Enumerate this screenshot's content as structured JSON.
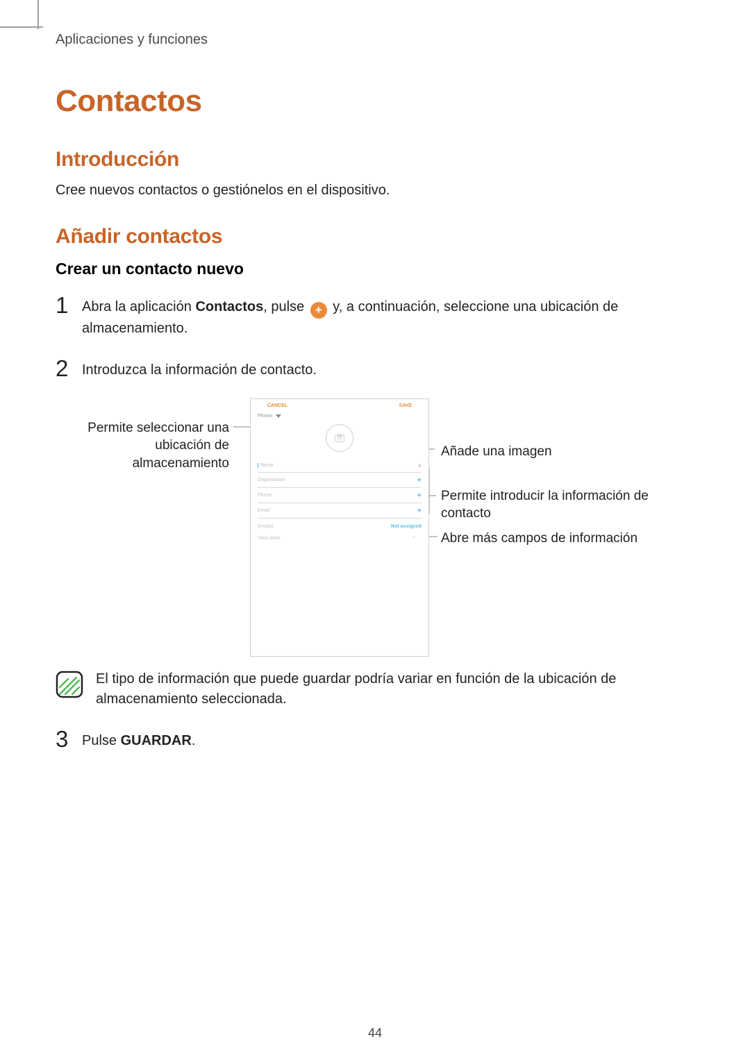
{
  "running_head": "Aplicaciones y funciones",
  "h1": "Contactos",
  "intro": {
    "heading": "Introducción",
    "text": "Cree nuevos contactos o gestiónelos en el dispositivo."
  },
  "add": {
    "heading": "Añadir contactos",
    "sub": "Crear un contacto nuevo"
  },
  "steps": {
    "s1_num": "1",
    "s1_a": "Abra la aplicación ",
    "s1_app": "Contactos",
    "s1_b": ", pulse ",
    "plus_glyph": "+",
    "s1_c": " y, a continuación, seleccione una ubicación de almacenamiento.",
    "s2_num": "2",
    "s2": "Introduzca la información de contacto.",
    "s3_num": "3",
    "s3_a": "Pulse ",
    "s3_b": "GUARDAR",
    "s3_c": "."
  },
  "phone": {
    "cancel": "CANCEL",
    "save": "SAVE",
    "location": "Phone",
    "camera_glyph": "⌂",
    "name": "Name",
    "org": "Organisation",
    "phone": "Phone",
    "email": "Email",
    "groups": "Groups",
    "not_assigned": "Not assigned",
    "view_more": "View more",
    "caret": "˅",
    "plus": "+"
  },
  "annotations": {
    "left1": "Permite seleccionar una ubicación de almacenamiento",
    "right1": "Añade una imagen",
    "right2": "Permite introducir la información de contacto",
    "right3": "Abre más campos de información"
  },
  "note_text": "El tipo de información que puede guardar podría variar en función de la ubicación de almacenamiento seleccionada.",
  "page_number": "44"
}
